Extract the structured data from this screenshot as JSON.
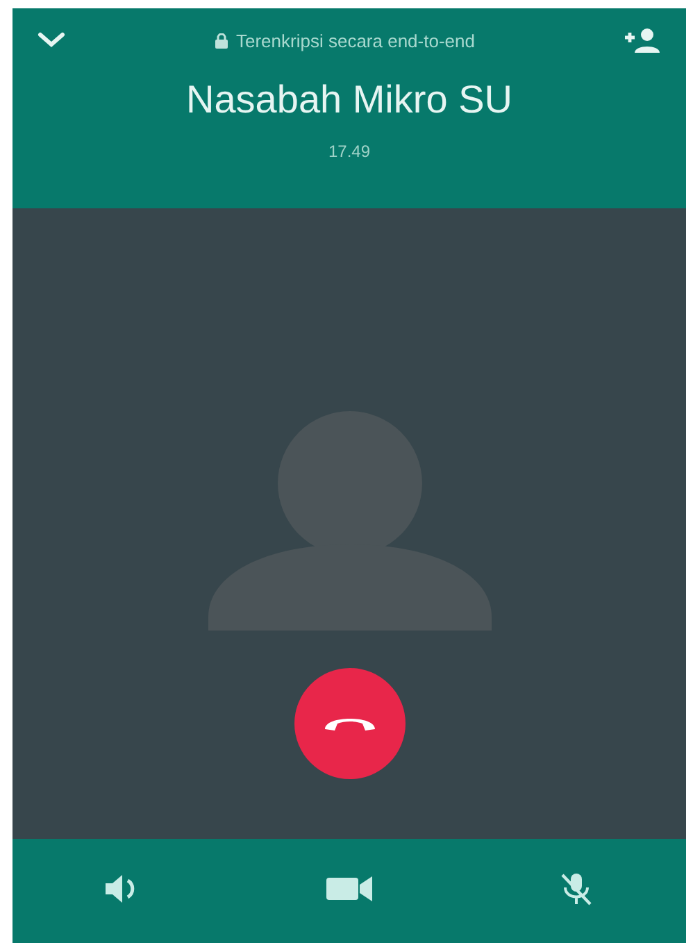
{
  "header": {
    "encryption_notice": "Terenkripsi secara end-to-end",
    "contact_name": "Nasabah Mikro SU",
    "call_duration": "17.49"
  }
}
